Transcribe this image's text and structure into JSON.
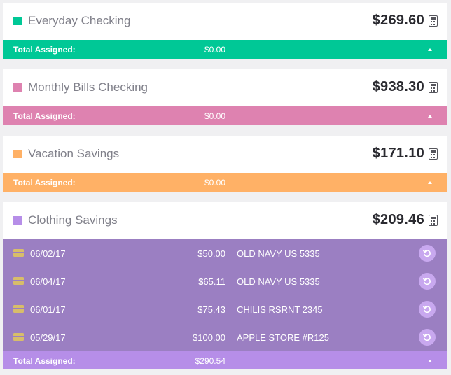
{
  "footer_label": "Total Assigned:",
  "accounts": [
    {
      "name": "Everyday Checking",
      "balance": "$269.60",
      "total_assigned": "$0.00",
      "color": "#00c896"
    },
    {
      "name": "Monthly Bills Checking",
      "balance": "$938.30",
      "total_assigned": "$0.00",
      "color": "#de82b0"
    },
    {
      "name": "Vacation Savings",
      "balance": "$171.10",
      "total_assigned": "$0.00",
      "color": "#ffb166"
    },
    {
      "name": "Clothing Savings",
      "balance": "$209.46",
      "total_assigned": "$290.54",
      "color": "#b68ee8",
      "transactions": [
        {
          "date": "06/02/17",
          "amount": "$50.00",
          "payee": "OLD NAVY US 5335"
        },
        {
          "date": "06/04/17",
          "amount": "$65.11",
          "payee": "OLD NAVY US 5335"
        },
        {
          "date": "06/01/17",
          "amount": "$75.43",
          "payee": "CHILIS RSRNT 2345"
        },
        {
          "date": "05/29/17",
          "amount": "$100.00",
          "payee": "APPLE STORE #R125"
        }
      ]
    }
  ],
  "icons": {
    "balance": "calculator-icon",
    "transaction": "credit-card-icon",
    "undo": "undo-icon",
    "collapse": "caret-up-icon"
  },
  "colors": {
    "transaction_bg": "#9b7fc2",
    "card_icon": "#d8bd6a",
    "undo_bg": "#c8a8ef"
  }
}
